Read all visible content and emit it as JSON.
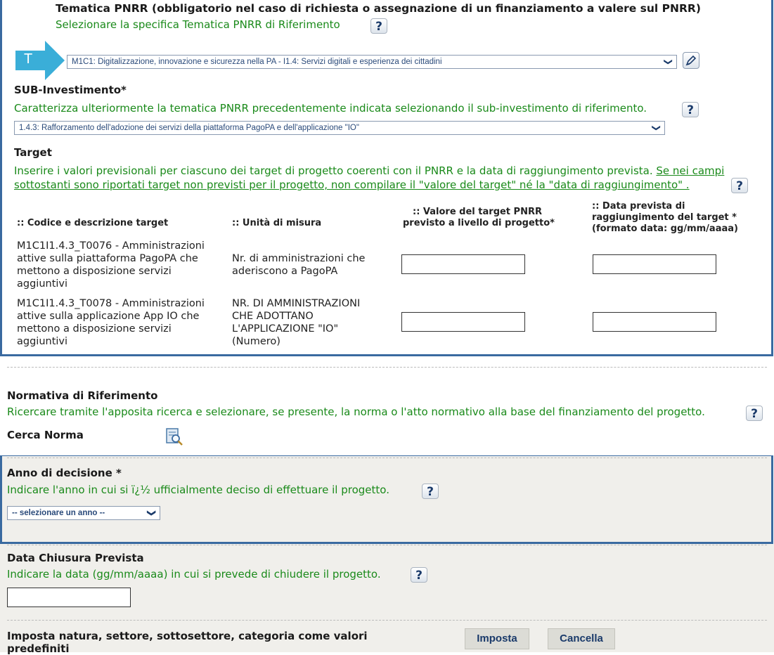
{
  "tematica": {
    "title": "Tematica PNRR (obbligatorio nel caso di richiesta o assegnazione di un finanziamento a valere sul PNRR)",
    "hint": "Selezionare la specifica Tematica PNRR di Riferimento",
    "badge": "T",
    "selected": "M1C1: Digitalizzazione, innovazione e sicurezza nella PA - I1.4: Servizi digitali e esperienza dei cittadini"
  },
  "sub_investimento": {
    "title": "SUB-Investimento*",
    "hint": "Caratterizza ulteriormente la tematica PNRR precedentemente indicata selezionando il sub-investimento di riferimento.",
    "selected": "1.4.3: Rafforzamento dell'adozione dei servizi della piattaforma PagoPA e dell'applicazione \"IO\""
  },
  "target": {
    "title": "Target",
    "hint_line1": "Inserire i valori previsionali per ciascuno dei target di progetto coerenti con il PNRR e la data di raggiungimento prevista.",
    "hint_link_part1": "Se nei campi",
    "hint_link_part2": "sottostanti sono riportati target non previsti per il progetto, non compilare il \"valore del target\" né la \"data di raggiungimento\" .",
    "columns": {
      "codice": ":: Codice e descrizione target",
      "unita": ":: Unità di misura",
      "valore_l1": ":: Valore del target PNRR",
      "valore_l2": "previsto a livello di progetto*",
      "data_l1": ":: Data prevista di",
      "data_l2": "raggiungimento del target *",
      "data_l3": "(formato data: gg/mm/aaaa)"
    },
    "rows": [
      {
        "codice": [
          "M1C1I1.4.3_T0076 - Amministrazioni",
          "attive sulla piattaforma PagoPA che",
          "mettono a disposizione servizi",
          "aggiuntivi"
        ],
        "unita": [
          "Nr. di amministrazioni che",
          "aderiscono a PagoPA"
        ]
      },
      {
        "codice": [
          "M1C1I1.4.3_T0078 - Amministrazioni",
          "attive sulla applicazione App IO che",
          "mettono a disposizione servizi",
          "aggiuntivi"
        ],
        "unita": [
          "NR. DI AMMINISTRAZIONI",
          "CHE ADOTTANO",
          "L'APPLICAZIONE \"IO\"",
          "(Numero)"
        ]
      }
    ]
  },
  "normativa": {
    "title": "Normativa di Riferimento",
    "hint": "Ricercare tramite l'apposita ricerca e selezionare, se presente, la norma o l'atto normativo alla base del finanziamento del progetto.",
    "cerca_label": "Cerca Norma"
  },
  "anno": {
    "title": "Anno di decisione *",
    "hint": "Indicare l'anno in cui si ï¿½ ufficialmente deciso di effettuare il progetto.",
    "selected": "-- selezionare un anno --"
  },
  "chiusura": {
    "title": "Data Chiusura Prevista",
    "hint": "Indicare la data (gg/mm/aaaa) in cui si prevede di chiudere il progetto."
  },
  "imposta": {
    "label_l1": "Imposta natura, settore, sottosettore, categoria come valori",
    "label_l2": "predefiniti",
    "imposta_button": "Imposta",
    "cancella_button": "Cancella"
  },
  "help_glyph": "?",
  "chevron_glyph": "❯",
  "colors": {
    "frame_blue": "#3a6aa0",
    "hint_green": "#1a8a1a",
    "arrow_cyan": "#3aaed8",
    "panel_grey": "#f0efeb"
  }
}
